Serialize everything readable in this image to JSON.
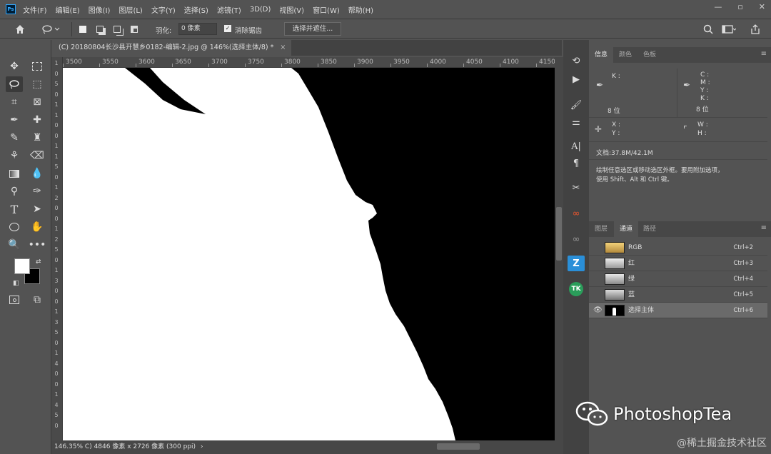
{
  "menubar": {
    "logo": "Ps",
    "items": [
      "文件(F)",
      "编辑(E)",
      "图像(I)",
      "图层(L)",
      "文字(Y)",
      "选择(S)",
      "滤镜(T)",
      "3D(D)",
      "视图(V)",
      "窗口(W)",
      "帮助(H)"
    ]
  },
  "options": {
    "feather_label": "羽化:",
    "feather_value": "0 像素",
    "antialias_label": "消除锯齿",
    "antialias_checked": true,
    "select_mask_button": "选择并遮住..."
  },
  "document_tab": {
    "title": "(C) 20180804长沙县开慧乡0182-编辑-2.jpg @ 146%(选择主体/8) *",
    "close": "×"
  },
  "ruler_top": [
    "3500",
    "3550",
    "3600",
    "3650",
    "3700",
    "3750",
    "3800",
    "3850",
    "3900",
    "3950",
    "4000",
    "4050",
    "4100",
    "4150"
  ],
  "ruler_left": [
    "1",
    "0",
    "5",
    "0",
    "1",
    "1",
    "0",
    "0",
    "1",
    "1",
    "5",
    "0",
    "1",
    "2",
    "0",
    "0",
    "1",
    "2",
    "5",
    "0",
    "1",
    "3",
    "0",
    "0",
    "1",
    "3",
    "5",
    "0",
    "1",
    "4",
    "0",
    "0",
    "1",
    "4",
    "5",
    "0"
  ],
  "status": {
    "zoom": "146.35%",
    "doc_info": "C) 4846 像素 x 2726 像素 (300 ppi)",
    "arrow": "›"
  },
  "info_panel": {
    "tabs": [
      "信息",
      "颜色",
      "色板"
    ],
    "k_label": "K :",
    "c_label": "C :",
    "m_label": "M :",
    "y_label": "Y :",
    "k2_label": "K :",
    "bit1": "8 位",
    "bit2": "8 位",
    "x_label": "X :",
    "y_coord_label": "Y :",
    "w_label": "W :",
    "h_label": "H :",
    "doc_size": "文档:37.8M/42.1M",
    "hint_line1": "绘制任意选区或移动选区外框。要用附加选项，",
    "hint_line2": "使用 Shift、Alt 和 Ctrl 键。"
  },
  "channels_panel": {
    "tabs": [
      "图层",
      "通道",
      "路径"
    ],
    "channels": [
      {
        "name": "RGB",
        "key": "Ctrl+2",
        "visible": false
      },
      {
        "name": "红",
        "key": "Ctrl+3",
        "visible": false
      },
      {
        "name": "绿",
        "key": "Ctrl+4",
        "visible": false
      },
      {
        "name": "蓝",
        "key": "Ctrl+5",
        "visible": false
      },
      {
        "name": "选择主体",
        "key": "Ctrl+6",
        "visible": true
      }
    ]
  },
  "watermark": {
    "text": "PhotoshopTea",
    "site": "@稀土掘金技术社区"
  },
  "colors": {
    "ui_bg": "#535353",
    "panel_dark": "#424242",
    "accent_blue": "#31a8ff",
    "selected_row": "#6a6a6a"
  }
}
